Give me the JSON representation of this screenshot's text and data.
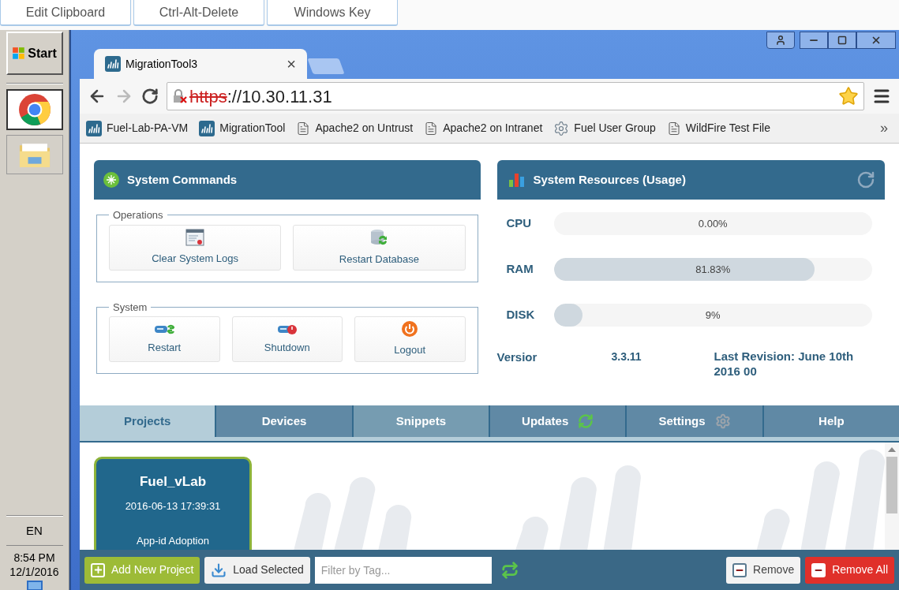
{
  "remote_toolbar": [
    "Edit Clipboard",
    "Ctrl-Alt-Delete",
    "Windows Key"
  ],
  "taskbar": {
    "start": "Start",
    "language": "EN",
    "time": "8:54 PM",
    "date": "12/1/2016"
  },
  "browser": {
    "tab": {
      "title": "MigrationTool3",
      "close": "×"
    },
    "url": {
      "scheme": "https",
      "rest": "://10.30.11.31",
      "insecure": true
    },
    "bookmarks": [
      {
        "kind": "app",
        "label": "Fuel-Lab-PA-VM"
      },
      {
        "kind": "app",
        "label": "MigrationTool"
      },
      {
        "kind": "page",
        "label": "Apache2 on Untrust"
      },
      {
        "kind": "page",
        "label": "Apache2 on Intranet"
      },
      {
        "kind": "gear",
        "label": "Fuel User Group"
      },
      {
        "kind": "page",
        "label": "WildFire Test File"
      }
    ],
    "more": "»"
  },
  "system_commands": {
    "title": "System Commands",
    "groups": [
      {
        "legend": "Operations",
        "buttons": [
          {
            "kind": "logs",
            "label": "Clear System Logs"
          },
          {
            "kind": "database",
            "label": "Restart Database"
          }
        ]
      },
      {
        "legend": "System",
        "buttons": [
          {
            "kind": "restart",
            "label": "Restart"
          },
          {
            "kind": "shutdown",
            "label": "Shutdown"
          },
          {
            "kind": "logout",
            "label": "Logout"
          }
        ]
      }
    ]
  },
  "resources": {
    "title": "System Resources (Usage)",
    "meters": [
      {
        "name": "CPU",
        "reading": "0.00%"
      },
      {
        "name": "RAM",
        "level": 0.8183,
        "reading": "81.83%"
      },
      {
        "name": "DISK",
        "level": 0.09,
        "reading": "9%"
      }
    ],
    "version_label": "Versior",
    "version": "3.3.11",
    "revision": "Last Revision: June 10th 2016 00"
  },
  "tabs": [
    {
      "kind": "plain",
      "label": "Projects",
      "selected": true,
      "hovered": false
    },
    {
      "kind": "plain",
      "label": "Devices",
      "selected": false,
      "hovered": false
    },
    {
      "kind": "plain",
      "label": "Snippets",
      "selected": false,
      "hovered": true
    },
    {
      "kind": "sync",
      "label": "Updates",
      "selected": false,
      "hovered": false
    },
    {
      "kind": "gear",
      "label": "Settings",
      "selected": false,
      "hovered": false
    },
    {
      "kind": "plain",
      "label": "Help",
      "selected": false,
      "hovered": false
    }
  ],
  "projects": [
    {
      "name": "Fuel_vLab",
      "date": "2016-06-13 17:39:31",
      "tag": "App-id Adoption",
      "selected": true
    }
  ],
  "bottom_bar": {
    "add": "Add New Project",
    "load": "Load Selected",
    "filter_placeholder": "Filter by Tag...",
    "remove": "Remove",
    "remove_all": "Remove All"
  }
}
